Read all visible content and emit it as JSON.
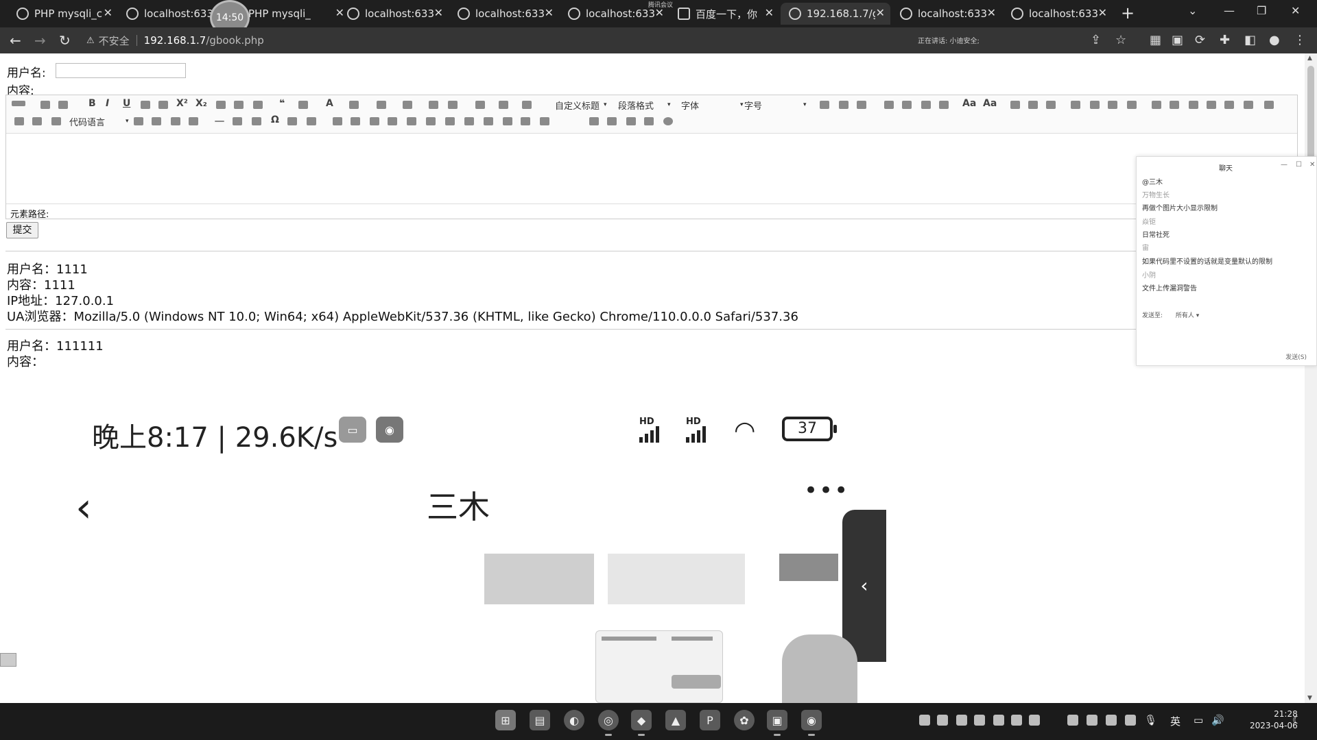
{
  "browser": {
    "tabs": [
      {
        "title": "PHP mysqli_c",
        "active": false
      },
      {
        "title": "localhost:633",
        "active": false
      },
      {
        "title": "PHP mysqli_",
        "active": false
      },
      {
        "title": "localhost:633",
        "active": false
      },
      {
        "title": "localhost:633",
        "active": false
      },
      {
        "title": "localhost:633",
        "active": false
      },
      {
        "title": "百度一下，你",
        "active": false
      },
      {
        "title": "192.168.1.7/g",
        "active": true
      },
      {
        "title": "localhost:633",
        "active": false
      },
      {
        "title": "localhost:633",
        "active": false
      }
    ],
    "timer_bubble": "14:50",
    "meeting_label": "腾讯会议",
    "address": {
      "security_label": "不安全",
      "host": "192.168.1.7",
      "path": "/gbook.php"
    },
    "speaking_indicator": "正在讲话: 小迪安全;"
  },
  "form": {
    "username_label": "用户名:",
    "content_label": "内容:",
    "username_value": "",
    "editor": {
      "toolbar_combos": {
        "custom_heading": "自定义标题",
        "paragraph_format": "段落格式",
        "font_family": "字体",
        "font_size": "字号",
        "code_language": "代码语言"
      },
      "element_path_label": "元素路径:"
    },
    "submit_label": "提交"
  },
  "entries": [
    {
      "username": "用户名：1111",
      "content": "内容：1111",
      "ip": "IP地址：127.0.0.1",
      "ua": "UA浏览器：Mozilla/5.0 (Windows NT 10.0; Win64; x64) AppleWebKit/537.36 (KHTML, like Gecko) Chrome/110.0.0.0 Safari/537.36"
    },
    {
      "username": "用户名：111111",
      "content": "内容："
    }
  ],
  "chat_popup": {
    "title": "聊天",
    "messages": [
      {
        "text": "@三木",
        "is_name": false
      },
      {
        "text": "万物生长",
        "is_name": true
      },
      {
        "text": "再做个图片大小显示限制",
        "is_name": false
      },
      {
        "text": "焱钜",
        "is_name": true
      },
      {
        "text": "日常社死",
        "is_name": false
      },
      {
        "text": "宙",
        "is_name": true
      },
      {
        "text": "如果代码里不设置的话就是变量默认的限制",
        "is_name": false
      },
      {
        "text": "小阴",
        "is_name": true
      },
      {
        "text": "文件上传漏洞警告",
        "is_name": false
      }
    ],
    "send_to_label": "发送至:",
    "send_to_value": "所有人",
    "send_button": "发送(S)"
  },
  "phone": {
    "status_time": "晚上8:17 | 29.6K/s",
    "signal_label_1": "HD",
    "signal_label_2": "HD",
    "battery": "37",
    "chat_name": "三木",
    "more": "•••"
  },
  "taskbar": {
    "input_method": "英",
    "time": "21:28",
    "date": "2023-04-06"
  }
}
